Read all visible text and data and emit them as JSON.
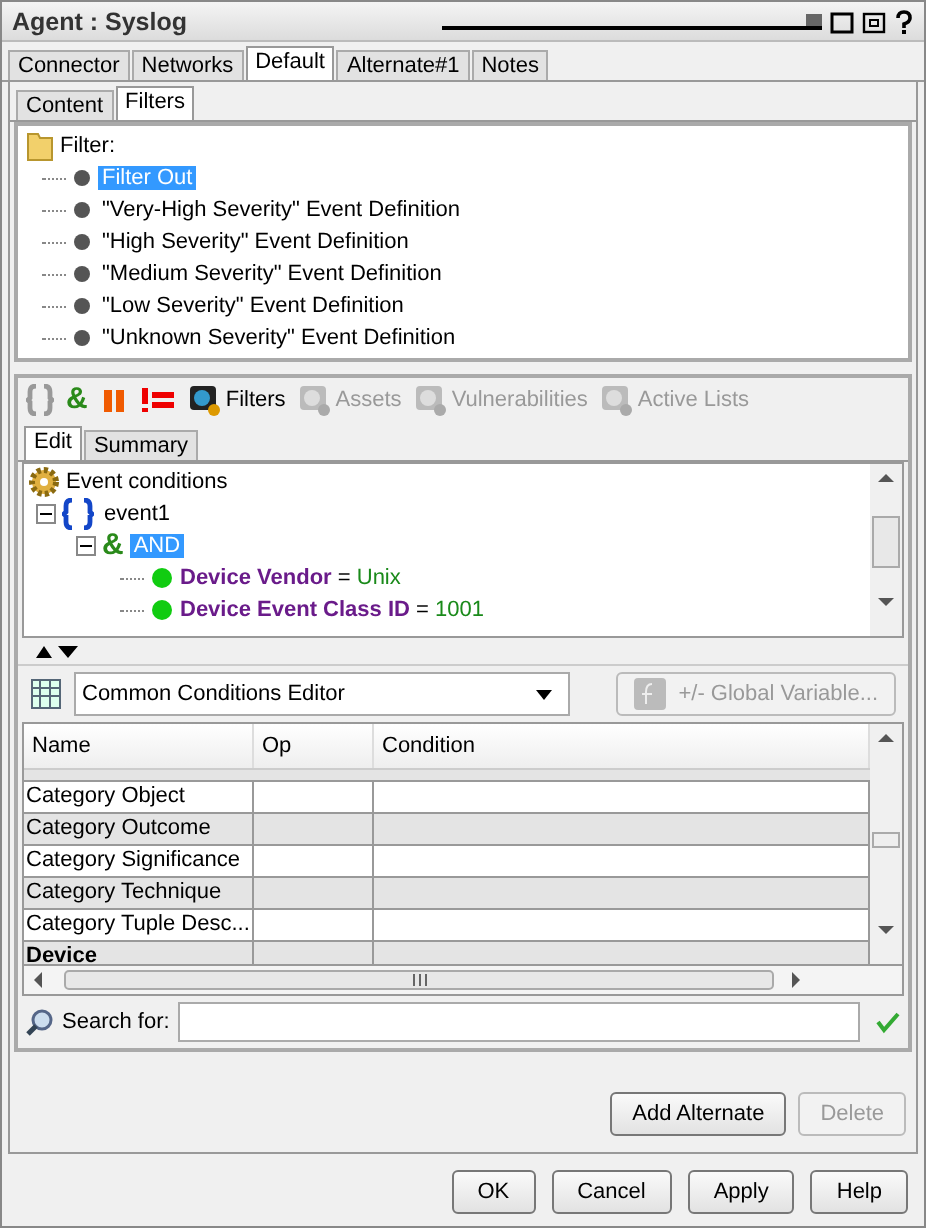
{
  "window": {
    "title": "Agent : Syslog",
    "slider": {
      "level": 1
    }
  },
  "tabs": [
    {
      "label": "Connector",
      "selected": false
    },
    {
      "label": "Networks",
      "selected": false
    },
    {
      "label": "Default",
      "selected": true
    },
    {
      "label": "Alternate#1",
      "selected": false
    },
    {
      "label": "Notes",
      "selected": false
    }
  ],
  "subtabs": [
    {
      "label": "Content",
      "selected": false
    },
    {
      "label": "Filters",
      "selected": true
    }
  ],
  "filter_tree": {
    "root": "Filter:",
    "items": [
      {
        "label": "Filter Out",
        "selected": true
      },
      {
        "label": "\"Very-High Severity\" Event Definition",
        "selected": false
      },
      {
        "label": "\"High Severity\" Event Definition",
        "selected": false
      },
      {
        "label": "\"Medium Severity\" Event Definition",
        "selected": false
      },
      {
        "label": "\"Low Severity\" Event Definition",
        "selected": false
      },
      {
        "label": "\"Unknown Severity\" Event Definition",
        "selected": false
      }
    ]
  },
  "toolbar_symbol": "&",
  "toolbar": [
    {
      "label": "Filters",
      "disabled": false
    },
    {
      "label": "Assets",
      "disabled": true
    },
    {
      "label": "Vulnerabilities",
      "disabled": true
    },
    {
      "label": "Active Lists",
      "disabled": true
    }
  ],
  "editor_tabs": [
    {
      "label": "Edit",
      "selected": true
    },
    {
      "label": "Summary",
      "selected": false
    }
  ],
  "conditions": {
    "label": "Event conditions",
    "children": [
      {
        "kind": "event",
        "label": "event1",
        "expanded": true,
        "selected": false,
        "children": [
          {
            "kind": "and",
            "symbol": "&",
            "label": "AND",
            "expanded": true,
            "selected": true,
            "children": [
              {
                "kind": "condition",
                "field": "Device Vendor",
                "op": "=",
                "value": "Unix"
              },
              {
                "kind": "condition",
                "field": "Device Event Class ID",
                "op": "=",
                "value": "1001"
              }
            ]
          }
        ]
      }
    ]
  },
  "editor_select": {
    "value": "Common Conditions Editor"
  },
  "global_variable_button": {
    "label": "+/- Global Variable...",
    "disabled": true
  },
  "table": {
    "columns": [
      "Name",
      "Op",
      "Condition"
    ],
    "rows": [
      {
        "kind": "field",
        "name": "Category Object",
        "op": "",
        "condition": ""
      },
      {
        "kind": "field",
        "name": "Category Outcome",
        "op": "",
        "condition": ""
      },
      {
        "kind": "field",
        "name": "Category Significance",
        "op": "",
        "condition": ""
      },
      {
        "kind": "field",
        "name": "Category Technique",
        "op": "",
        "condition": ""
      },
      {
        "kind": "field",
        "name": "Category Tuple Desc...",
        "op": "",
        "condition": ""
      },
      {
        "kind": "group",
        "name": "Device",
        "op": "",
        "condition": ""
      }
    ]
  },
  "search": {
    "label": "Search for:"
  },
  "alternate_buttons": [
    {
      "label": "Add Alternate",
      "disabled": false
    },
    {
      "label": "Delete",
      "disabled": true
    }
  ],
  "buttons": [
    "OK",
    "Cancel",
    "Apply",
    "Help"
  ]
}
